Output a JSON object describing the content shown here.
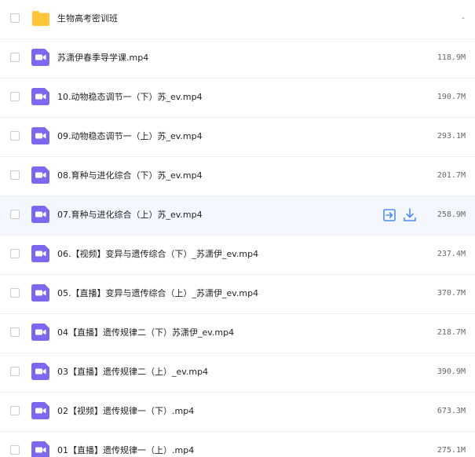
{
  "colors": {
    "folder": "#ffc63b",
    "video": "#7b68ee",
    "action": "#4a8ef0",
    "hover_row": "#f4f8fe"
  },
  "icons": {
    "folder": "folder-icon",
    "video": "video-file-icon",
    "share": "share-icon",
    "download": "download-icon"
  },
  "files": [
    {
      "type": "folder",
      "name": "生物高考密训班",
      "size": "-"
    },
    {
      "type": "video",
      "name": "苏潇伊春季导学课.mp4",
      "size": "118.9M"
    },
    {
      "type": "video",
      "name": "10.动物稳态调节一（下）苏_ev.mp4",
      "size": "190.7M"
    },
    {
      "type": "video",
      "name": "09.动物稳态调节一（上）苏_ev.mp4",
      "size": "293.1M"
    },
    {
      "type": "video",
      "name": "08.育种与进化综合（下）苏_ev.mp4",
      "size": "201.7M"
    },
    {
      "type": "video",
      "name": "07.育种与进化综合（上）苏_ev.mp4",
      "size": "258.9M",
      "hovered": true
    },
    {
      "type": "video",
      "name": "06.【视频】变异与遗传综合（下）_苏潇伊_ev.mp4",
      "size": "237.4M"
    },
    {
      "type": "video",
      "name": "05.【直播】变异与遗传综合（上）_苏潇伊_ev.mp4",
      "size": "370.7M"
    },
    {
      "type": "video",
      "name": "04【直播】遗传规律二（下）苏潇伊_ev.mp4",
      "size": "218.7M"
    },
    {
      "type": "video",
      "name": "03【直播】遗传规律二（上）_ev.mp4",
      "size": "390.9M"
    },
    {
      "type": "video",
      "name": "02【视频】遗传规律一（下）.mp4",
      "size": "673.3M"
    },
    {
      "type": "video",
      "name": "01【直播】遗传规律一（上）.mp4",
      "size": "275.1M"
    }
  ]
}
